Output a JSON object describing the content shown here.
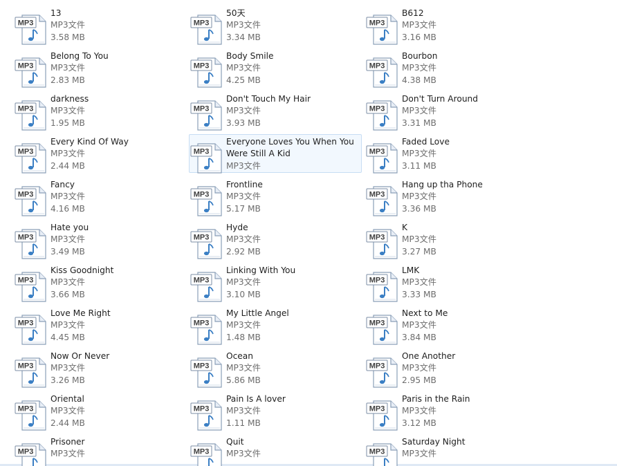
{
  "colors": {
    "background": "#ffffff",
    "selection_fill": "#f2f8fe",
    "selection_border": "#c7ddf3",
    "name_text": "#1e1e1e",
    "meta_text": "#6d6d6d",
    "icon_blue": "#3b7fc4"
  },
  "icon": {
    "name": "mp3-file-icon",
    "badge": "MP3"
  },
  "files": [
    {
      "name": "13",
      "type": "MP3文件",
      "size": "3.58 MB"
    },
    {
      "name": "50天",
      "type": "MP3文件",
      "size": "3.34 MB"
    },
    {
      "name": "B612",
      "type": "MP3文件",
      "size": "3.16 MB"
    },
    {
      "name": "Belong To You",
      "type": "MP3文件",
      "size": "2.83 MB"
    },
    {
      "name": "Body Smile",
      "type": "MP3文件",
      "size": "4.25 MB"
    },
    {
      "name": "Bourbon",
      "type": "MP3文件",
      "size": "4.38 MB"
    },
    {
      "name": "darkness",
      "type": "MP3文件",
      "size": "1.95 MB"
    },
    {
      "name": "Don't Touch My Hair",
      "type": "MP3文件",
      "size": "3.93 MB"
    },
    {
      "name": "Don't Turn Around",
      "type": "MP3文件",
      "size": "3.31 MB"
    },
    {
      "name": "Every Kind Of Way",
      "type": "MP3文件",
      "size": "2.44 MB"
    },
    {
      "name": "Everyone Loves You When You Were Still A Kid",
      "type": "MP3文件",
      "size": "",
      "selected": true
    },
    {
      "name": "Faded Love",
      "type": "MP3文件",
      "size": "3.11 MB"
    },
    {
      "name": "Fancy",
      "type": "MP3文件",
      "size": "4.16 MB"
    },
    {
      "name": "Frontline",
      "type": "MP3文件",
      "size": "5.17 MB"
    },
    {
      "name": "Hang up tha Phone",
      "type": "MP3文件",
      "size": "3.36 MB"
    },
    {
      "name": "Hate you",
      "type": "MP3文件",
      "size": "3.49 MB"
    },
    {
      "name": "Hyde",
      "type": "MP3文件",
      "size": "2.92 MB"
    },
    {
      "name": "K",
      "type": "MP3文件",
      "size": "3.27 MB"
    },
    {
      "name": "Kiss Goodnight",
      "type": "MP3文件",
      "size": "3.66 MB"
    },
    {
      "name": "Linking With You",
      "type": "MP3文件",
      "size": "3.10 MB"
    },
    {
      "name": "LMK",
      "type": "MP3文件",
      "size": "3.33 MB"
    },
    {
      "name": "Love Me Right",
      "type": "MP3文件",
      "size": "4.45 MB"
    },
    {
      "name": "My Little Angel",
      "type": "MP3文件",
      "size": "1.48 MB"
    },
    {
      "name": "Next to Me",
      "type": "MP3文件",
      "size": "3.84 MB"
    },
    {
      "name": "Now Or Never",
      "type": "MP3文件",
      "size": "3.26 MB"
    },
    {
      "name": "Ocean",
      "type": "MP3文件",
      "size": "5.86 MB"
    },
    {
      "name": "One Another",
      "type": "MP3文件",
      "size": "2.95 MB"
    },
    {
      "name": "Oriental",
      "type": "MP3文件",
      "size": "2.44 MB"
    },
    {
      "name": "Pain Is A lover",
      "type": "MP3文件",
      "size": "1.11 MB"
    },
    {
      "name": "Paris in the Rain",
      "type": "MP3文件",
      "size": "3.12 MB"
    },
    {
      "name": "Prisoner",
      "type": "MP3文件",
      "size": ""
    },
    {
      "name": "Quit",
      "type": "MP3文件",
      "size": ""
    },
    {
      "name": "Saturday Night",
      "type": "MP3文件",
      "size": ""
    }
  ]
}
